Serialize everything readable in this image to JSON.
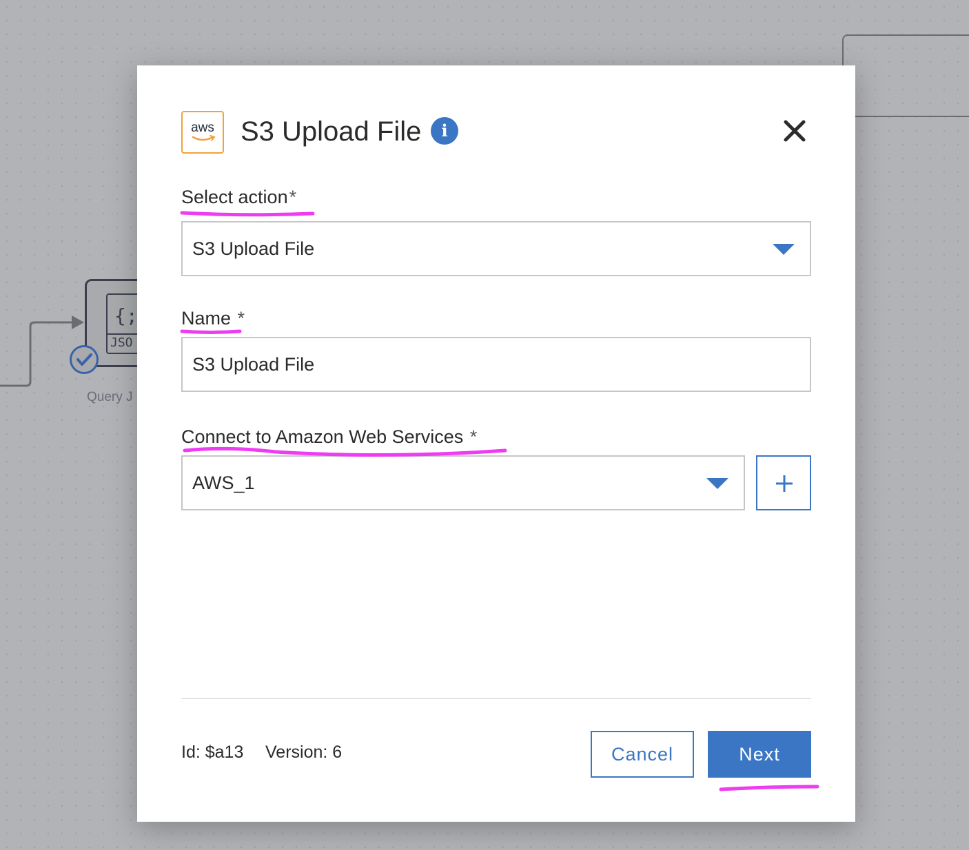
{
  "background": {
    "node_label": "Query J",
    "node_icon_braces": "{;}",
    "node_icon_text": "JSO"
  },
  "modal": {
    "logo_text": "aws",
    "title": "S3 Upload File",
    "info_icon": "i"
  },
  "form": {
    "select_action": {
      "label": "Select action",
      "required_mark": "*",
      "value": "S3 Upload File"
    },
    "name": {
      "label": "Name",
      "required_mark": "*",
      "value": "S3 Upload File"
    },
    "connection": {
      "label": "Connect to Amazon Web Services",
      "required_mark": "*",
      "value": "AWS_1",
      "add_button": "+"
    }
  },
  "footer": {
    "id_text": "Id: $a13",
    "version_text": "Version: 6",
    "cancel_label": "Cancel",
    "next_label": "Next"
  },
  "colors": {
    "accent": "#3a76c4",
    "aws_orange": "#f0a23c",
    "annotation_magenta": "#ee3cf2"
  },
  "icons": [
    "aws-logo-icon",
    "info-icon",
    "close-icon",
    "dropdown-arrow-icon",
    "plus-icon",
    "check-icon",
    "json-file-icon"
  ]
}
